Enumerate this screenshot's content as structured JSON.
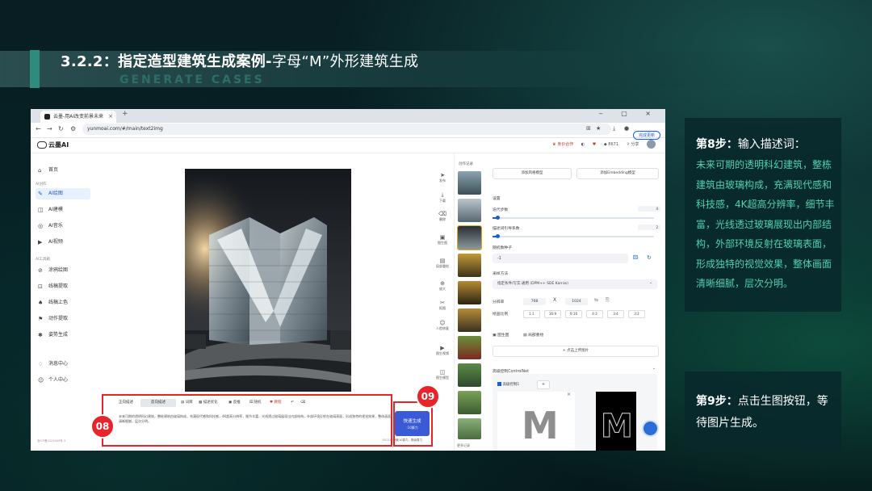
{
  "slide": {
    "title_bold": "3.2.2：指定造型建筑生成案例-",
    "title_rest": "字母“M”外形建筑生成",
    "subtitle": "GENERATE CASES"
  },
  "browser": {
    "tab_title": "云墨-用AI改变前景未来",
    "url": "yunmoai.com/#/main/text2img",
    "update_label": "完成更新"
  },
  "app": {
    "logo": "云墨AI",
    "header": {
      "vip": "身价合作",
      "points": "8671",
      "share": "分享"
    },
    "sidebar": {
      "home": "首页",
      "section1": "AI创作",
      "items1": [
        "AI绘图",
        "AI建模",
        "AI音乐",
        "AI视频"
      ],
      "section2": "AI工具箱",
      "items2": [
        "涂鸦绘图",
        "线稿提取",
        "线稿上色",
        "动作提取",
        "姿势生成"
      ],
      "messages": "消息中心",
      "profile": "个人中心",
      "footer": "浙ICP备2023000号-3"
    },
    "history": {
      "title": "创作记录",
      "more": "更多记录"
    },
    "tools": [
      "发布",
      "下载",
      "删除",
      "图生图",
      "局部重绘",
      "放大",
      "抠图",
      "人脸修复",
      "图生视频",
      "图生模型"
    ],
    "settings": {
      "add_model": "添加风格模型",
      "add_embedding": "添加Embedding模型",
      "section": "设置",
      "steps_label": "迭代步数",
      "steps_value": "4",
      "cfg_label": "描述词引导系数",
      "cfg_value": "2",
      "seed_label": "随机数种子",
      "seed_value": "-1",
      "sampler_label": "采样方法",
      "sampler_value": "指定条件/写实·通用 (DPM++ SDE Karras)",
      "res_label": "分辨率",
      "width": "768",
      "x": "X",
      "height": "1024",
      "ratio_label": "绘画比例",
      "ratios": [
        "1:1",
        "16:9",
        "9:16",
        "4:3",
        "3:4",
        "3:2"
      ],
      "img2img": "图生图",
      "inpaint": "局部重绘",
      "upload": "+ 点击上传图片",
      "controlnet": "高级控制ControlNet",
      "cn_tab": "高级控制1",
      "cn_plus": "+"
    },
    "prompt": {
      "tab_positive": "正向描述",
      "tab_negative": "反向描述",
      "tools": [
        "词库",
        "描述优化",
        "反推",
        "随机",
        "教程"
      ],
      "text": "未来可期的透明科幻建筑，整栋建筑由玻璃构成，充满现代感和科技感，4K超高分辨率，细节丰富，光线透过玻璃展现出内部结构，外部环境反射在玻璃表面，形成独特的视觉效果，整体画面清晰细腻，层次分明。",
      "count": "95/2000",
      "gen_button": "快速生成",
      "gen_sub": "-10算力",
      "gen_note": "消耗10算力，剩余算力"
    }
  },
  "callouts": {
    "step08": "08",
    "step09": "09"
  },
  "steps": {
    "step8_head": "第8步：",
    "step8_title": "输入描述词：",
    "step8_body": "未来可期的透明科幻建筑，整栋建筑由玻璃构成，充满现代感和科技感，4K超高分辨率，细节丰富，光线透过玻璃展现出内部结构，外部环境反射在玻璃表面，形成独特的视觉效果，整体画面清晰细腻，层次分明。",
    "step9_head": "第9步：",
    "step9_body": "点击生图按钮，等待图片生成。"
  },
  "colors": {
    "accent": "#4fd0b5",
    "callout": "#e8232a",
    "brand_blue": "#1a5fd0",
    "button": "#3a5ad6"
  }
}
